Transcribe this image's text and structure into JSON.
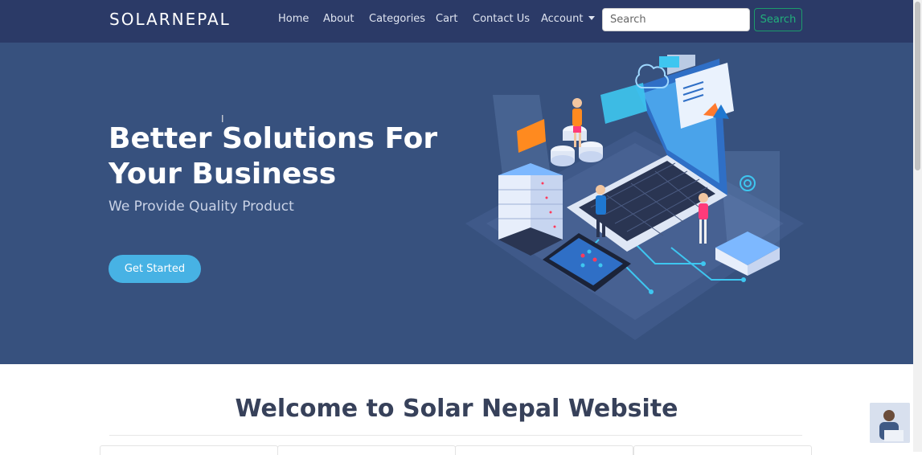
{
  "brand": "SOLARNEPAL",
  "nav": {
    "home": "Home",
    "about": "About",
    "categories": "Categories",
    "cart": "Cart",
    "contact": "Contact Us",
    "account": "Account"
  },
  "search": {
    "placeholder": "Search",
    "button": "Search"
  },
  "hero": {
    "title": "Better Solutions For Your Business",
    "subtitle": "We Provide Quality Product",
    "cta": "Get Started"
  },
  "welcome": {
    "title": "Welcome to Solar Nepal Website"
  },
  "colors": {
    "navbar": "#2b3a67",
    "hero": "#37517e",
    "cta": "#47b2e4",
    "search_button": "#22b07c"
  },
  "icons": {
    "account_caret": "caret-down-icon"
  }
}
